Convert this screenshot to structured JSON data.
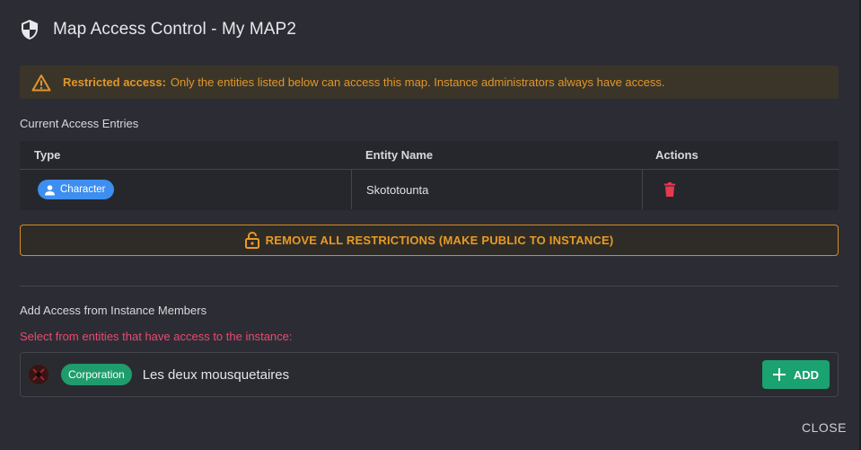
{
  "dialog": {
    "title": "Map Access Control - My MAP2"
  },
  "alert": {
    "strong": "Restricted access:",
    "text": "Only the entities listed below can access this map. Instance administrators always have access."
  },
  "access_entries": {
    "section_label": "Current Access Entries",
    "columns": [
      "Type",
      "Entity Name",
      "Actions"
    ],
    "rows": [
      {
        "type": "Character",
        "entity_name": "Skototounta"
      }
    ]
  },
  "remove_restrictions_label": "REMOVE ALL RESTRICTIONS (MAKE PUBLIC TO INSTANCE)",
  "add_access": {
    "section_label": "Add Access from Instance Members",
    "hint": "Select from entities that have access to the instance:",
    "members": [
      {
        "type": "Corporation",
        "name": "Les deux mousquetaires",
        "add_label": "ADD"
      }
    ]
  },
  "close_label": "CLOSE",
  "colors": {
    "background": "#2c2d34",
    "warning": "#e0962b",
    "character_chip": "#3d8ef0",
    "corporation_chip": "#1f9c6c",
    "delete": "#e53950",
    "hint": "#e84a6f"
  },
  "icons": {
    "title": "shield-icon",
    "alert": "warning-triangle-icon",
    "character": "person-icon",
    "delete": "trash-icon",
    "remove": "lock-open-icon",
    "add": "plus-icon"
  }
}
